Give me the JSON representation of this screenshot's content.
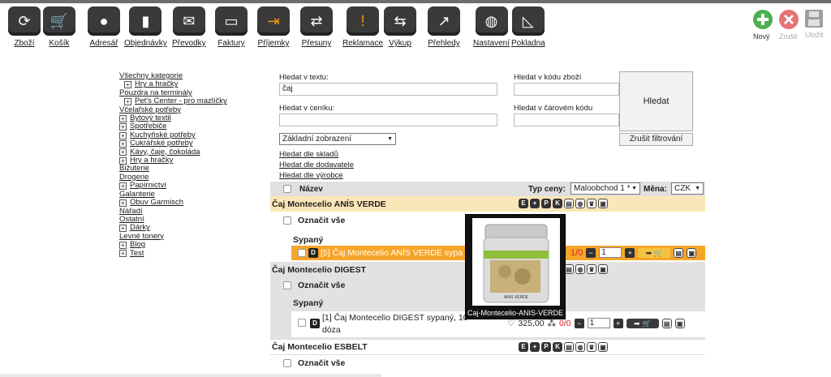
{
  "toolbar": {
    "items": [
      {
        "label": "Zboží",
        "icon": "refresh-icon"
      },
      {
        "label": "Košík",
        "icon": "cart-icon"
      },
      {
        "label": "Adresář",
        "icon": "person-icon"
      },
      {
        "label": "Objednávky",
        "icon": "phone-icon"
      },
      {
        "label": "Převodky",
        "icon": "envelope-icon"
      },
      {
        "label": "Faktury",
        "icon": "document-icon"
      },
      {
        "label": "Příjemky",
        "icon": "receipt-icon"
      },
      {
        "label": "Přesuny",
        "icon": "transfer-icon"
      },
      {
        "label": "Reklamace",
        "icon": "warning-icon"
      },
      {
        "label": "Výkup",
        "icon": "buyback-icon"
      },
      {
        "label": "Přehledy",
        "icon": "chart-icon"
      },
      {
        "label": "Nastavení",
        "icon": "globe-icon"
      },
      {
        "label": "Pokladna",
        "icon": "cash-register-icon"
      }
    ],
    "right": {
      "new": "Nový",
      "cancel": "Zrušit",
      "save": "Uložit"
    },
    "colors": {
      "new": "#4caf50",
      "cancel": "#e57373",
      "save": "#9e9e9e"
    }
  },
  "tree": [
    {
      "label": "Všechny kategorie",
      "plus": false,
      "indent": 0
    },
    {
      "label": "Hry a hračky",
      "plus": true,
      "indent": 1
    },
    {
      "label": "Pouzdra na terminály",
      "plus": false,
      "indent": 0
    },
    {
      "label": "Pet's Center - pro mazlíčky",
      "plus": true,
      "indent": 1
    },
    {
      "label": "Včelařské potřeby",
      "plus": false,
      "indent": 0
    },
    {
      "label": "Bytový textil",
      "plus": true,
      "indent": 0
    },
    {
      "label": "Spotřebiče",
      "plus": true,
      "indent": 0
    },
    {
      "label": "Kuchyňské potřeby",
      "plus": true,
      "indent": 0
    },
    {
      "label": "Cukrářské potřeby",
      "plus": true,
      "indent": 0
    },
    {
      "label": "Kávy, čaje, čokoláda",
      "plus": true,
      "indent": 0
    },
    {
      "label": "Hry a hračky",
      "plus": true,
      "indent": 0
    },
    {
      "label": "Bižuterie",
      "plus": false,
      "indent": 0
    },
    {
      "label": "Drogerie",
      "plus": false,
      "indent": 0
    },
    {
      "label": "Papírnictví",
      "plus": true,
      "indent": 0
    },
    {
      "label": "Galanterie",
      "plus": false,
      "indent": 0
    },
    {
      "label": "Obuv Garmisch",
      "plus": true,
      "indent": 0
    },
    {
      "label": "Nářadí",
      "plus": false,
      "indent": 0
    },
    {
      "label": "Ostatní",
      "plus": false,
      "indent": 0
    },
    {
      "label": "Dárky",
      "plus": true,
      "indent": 0
    },
    {
      "label": "Levné tonery",
      "plus": false,
      "indent": 0
    },
    {
      "label": "Blog",
      "plus": true,
      "indent": 0
    },
    {
      "label": "Test",
      "plus": true,
      "indent": 0
    }
  ],
  "search": {
    "text_label": "Hledat v textu:",
    "text_value": "čaj",
    "code_label": "Hledat v kódu zboží",
    "code_value": "",
    "pricelist_label": "Hledat v ceníku:",
    "pricelist_value": "",
    "barcode_label": "Hledat v čárovém kódu",
    "barcode_value": "",
    "view_select": "Základní zobrazení",
    "search_button": "Hledat",
    "cancel_filter": "Zrušit filtrování",
    "by_warehouse": "Hledat dle skladů",
    "by_supplier": "Hledat dle dodavatele",
    "by_manufacturer": "Hledat dle výrobce"
  },
  "table": {
    "col_name": "Název",
    "price_type_label": "Typ ceny:",
    "price_type_value": "Maloobchod 1 *",
    "currency_label": "Měna:",
    "currency_value": "CZK",
    "products": [
      {
        "name": "Čaj Montecelio ANÍS VERDE",
        "mark_all": "Označit vše",
        "group": "Sypaný",
        "item": "[5] Čaj Montecelio ANÍS VERDE sypa",
        "stock": "1/0",
        "qty": "1"
      },
      {
        "name": "Čaj Montecelio DIGEST",
        "mark_all": "Označit vše",
        "group": "Sypaný",
        "item_line1": "[1] Čaj Montecelio DIGEST sypaný, 10",
        "item_line2": "dóza",
        "price": "325,00",
        "stock": "0/0",
        "qty": "1"
      },
      {
        "name": "Čaj Montecelio ESBELT",
        "mark_all": "Označit vše"
      }
    ],
    "icon_letters": [
      "E",
      "+",
      "P",
      "K"
    ],
    "d_badge": "D"
  },
  "popup": {
    "caption": "Caj-Montecelio-ANIS-VERDE",
    "product_text": "ANIS VERDE"
  }
}
